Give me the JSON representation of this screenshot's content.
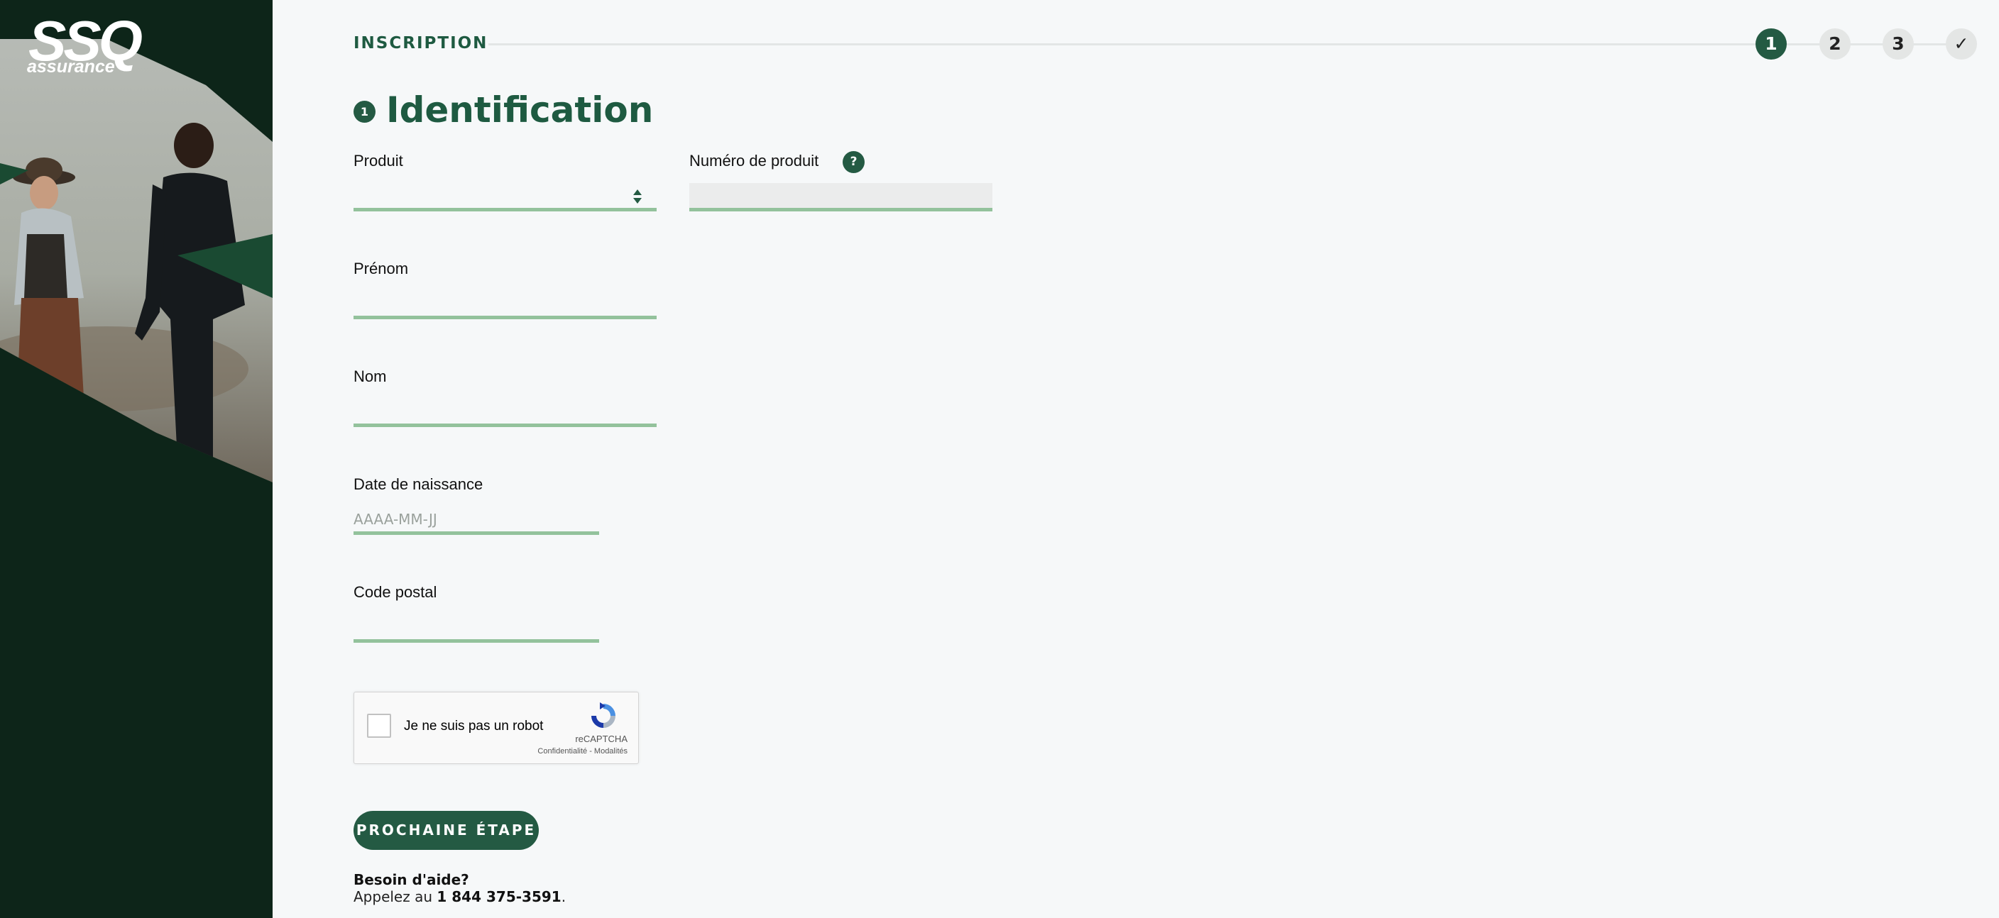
{
  "brand": {
    "logo_mark": "SSQ",
    "logo_word": "assurance"
  },
  "header": {
    "title": "INSCRIPTION",
    "steps": [
      "1",
      "2",
      "3",
      "✓"
    ],
    "active_step": 1
  },
  "section": {
    "number": "1",
    "title": "Identification"
  },
  "form": {
    "produit": {
      "label": "Produit",
      "value": ""
    },
    "numero_produit": {
      "label": "Numéro de produit",
      "help": "?"
    },
    "prenom": {
      "label": "Prénom",
      "value": ""
    },
    "nom": {
      "label": "Nom",
      "value": ""
    },
    "date_naissance": {
      "label": "Date de naissance",
      "placeholder": "AAAA-MM-JJ"
    },
    "code_postal": {
      "label": "Code postal",
      "value": ""
    }
  },
  "captcha": {
    "label": "Je ne suis pas un robot",
    "brand": "reCAPTCHA",
    "links": "Confidentialité - Modalités"
  },
  "actions": {
    "next_label": "PROCHAINE ÉTAPE"
  },
  "help": {
    "title": "Besoin d'aide?",
    "prefix": "Appelez au ",
    "phone": "1 844 375-3591",
    "suffix": "."
  },
  "colors": {
    "brand_green": "#245a43",
    "dark_panel": "#0d2519",
    "field_underline": "#93c29c",
    "background": "#f6f8f9"
  }
}
